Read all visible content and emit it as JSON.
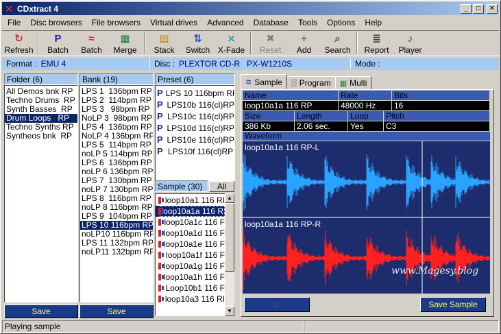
{
  "window": {
    "title": "CDxtract 4"
  },
  "menu": [
    "File",
    "Disc browsers",
    "File browsers",
    "Virtual drives",
    "Advanced",
    "Database",
    "Tools",
    "Options",
    "Help"
  ],
  "toolbar": [
    {
      "label": "Refresh",
      "icon": "refresh-icon",
      "glyph": "↻",
      "color": "#d03030"
    },
    {
      "label": "Batch",
      "icon": "preset-batch-icon",
      "glyph": "P",
      "color": "#1c2ab0"
    },
    {
      "label": "Batch",
      "icon": "sample-batch-icon",
      "glyph": "≈",
      "color": "#e02020"
    },
    {
      "label": "Merge",
      "icon": "merge-icon",
      "glyph": "▦",
      "color": "#208040"
    },
    {
      "label": "Stack",
      "icon": "stack-icon",
      "glyph": "▤",
      "color": "#d08020"
    },
    {
      "label": "Switch",
      "icon": "switch-icon",
      "glyph": "⇅",
      "color": "#2050c0"
    },
    {
      "label": "X-Fade",
      "icon": "xfade-icon",
      "glyph": "⨯",
      "color": "#20a0a0"
    },
    {
      "label": "Reset",
      "icon": "reset-icon",
      "glyph": "✖",
      "color": "#808080",
      "disabled": true
    },
    {
      "label": "Add",
      "icon": "add-icon",
      "glyph": "+",
      "color": "#20a020"
    },
    {
      "label": "Search",
      "icon": "search-icon",
      "glyph": "⌕",
      "color": "#404040"
    },
    {
      "label": "Report",
      "icon": "report-icon",
      "glyph": "≣",
      "color": "#404040"
    },
    {
      "label": "Player",
      "icon": "player-icon",
      "glyph": "♪",
      "color": "#404040"
    }
  ],
  "info": {
    "format_label": "Format :",
    "format_value": "EMU 4",
    "disc_label": "Disc :",
    "disc_value": "PLEXTOR CD-R   PX-W1210S",
    "mode_label": "Mode :",
    "mode_value": ""
  },
  "folder": {
    "title": "Folder (6)",
    "items": [
      "All Demos bnk RP",
      "Techno Drums  RP",
      "Synth Basses  RP",
      "Drum Loops   RP",
      "Techno Synths RP",
      "Syntheos bnk  RP"
    ],
    "selected": 3,
    "save_label": "Save"
  },
  "bank": {
    "title": "Bank (19)",
    "items": [
      "LPS 1  136bpm RP",
      "LPS 2  114bpm RP",
      "LPS 3   98bpm RP",
      "NoLP 3  98bpm RP",
      "LPS 4  136bpm RP",
      "NoLP 4 136bpm RP",
      "LPS 5  114bpm RP",
      "noLP 5 114bpm RP",
      "LPS 6  136bpm RP",
      "noLP 6 136bpm RP",
      "LPS 7  130bpm RP",
      "noLP 7 130bpm RP",
      "LPS 8  116bpm RP",
      "noLP 8 116bpm RP",
      "LPS 9  104bpm RP",
      "LPS 10 116bpm RP",
      "noLP10 116bpm RP",
      "LPS 11 132bpm RP",
      "noLP11 132bpm RP"
    ],
    "selected": 15,
    "save_label": "Save"
  },
  "preset": {
    "title": "Preset (6)",
    "items": [
      "LPS 10 116bpm RP",
      "LPS10b 116(cl)RP",
      "LPS10c 116(cl)RP",
      "LPS10d 116(cl)RP",
      "LPS10e 116(cl)RP",
      "LPS10f 116(cl)RP"
    ]
  },
  "sample": {
    "title": "Sample (30)",
    "all_label": "All",
    "items": [
      "loop10a1 116 RI",
      "loop10a1a 116 R",
      "loop10a1c 116 F",
      "loop10a1d 116 F",
      "loop10a1e 116 F",
      "loop10a1f 116 F",
      "loop10a1g 116 F",
      "loop10a1h 116 F",
      "Loop10b1 116 F",
      "loop10a3 116 RI"
    ],
    "selected": 1
  },
  "tabs": [
    {
      "label": "Sample",
      "icon": "waveform-tab-icon",
      "active": true
    },
    {
      "label": "Program",
      "icon": "keyboard-tab-icon",
      "active": false
    },
    {
      "label": "Multi",
      "icon": "multi-tab-icon",
      "active": false
    }
  ],
  "details": {
    "headers1": [
      "Name",
      "Rate",
      "Bits"
    ],
    "values1": [
      "loop10a1a 116 RP",
      "48000 Hz",
      "16"
    ],
    "headers2": [
      "Size",
      "Length",
      "Loop",
      "Pitch"
    ],
    "values2": [
      "386 Kb",
      "2.06 sec.",
      "Yes",
      "C3"
    ],
    "waveform_label": "Waveform",
    "left_channel": "loop10a1a 116 RP-L",
    "right_channel": "loop10a1a 116 RP-R",
    "left_color": "#29a3ff",
    "right_color": "#ff2020",
    "save_sample_label": "Save Sample"
  },
  "status": {
    "text": "Playing sample"
  },
  "watermark": "www.Magesy.blog"
}
